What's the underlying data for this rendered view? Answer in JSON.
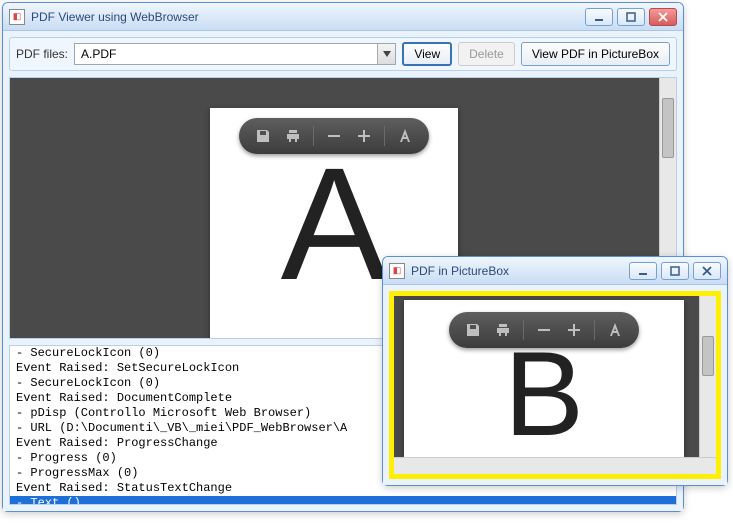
{
  "main_window": {
    "title": "PDF Viewer using WebBrowser",
    "toolbar": {
      "files_label": "PDF files:",
      "selected_file": "A.PDF",
      "view_btn": "View",
      "delete_btn": "Delete",
      "picturebox_btn": "View PDF in PictureBox"
    },
    "page_letter": "A"
  },
  "log_lines": [
    " - SecureLockIcon (0)",
    "Event Raised: SetSecureLockIcon",
    " - SecureLockIcon (0)",
    "Event Raised: DocumentComplete",
    " - pDisp (Controllo Microsoft Web Browser)",
    " - URL (D:\\Documenti\\_VB\\_miei\\PDF_WebBrowser\\A",
    "Event Raised: ProgressChange",
    " - Progress (0)",
    " - ProgressMax (0)",
    "Event Raised: StatusTextChange",
    " - Text ()"
  ],
  "log_selected_index": 10,
  "pic_window": {
    "title": "PDF in PictureBox",
    "page_letter": "B"
  }
}
